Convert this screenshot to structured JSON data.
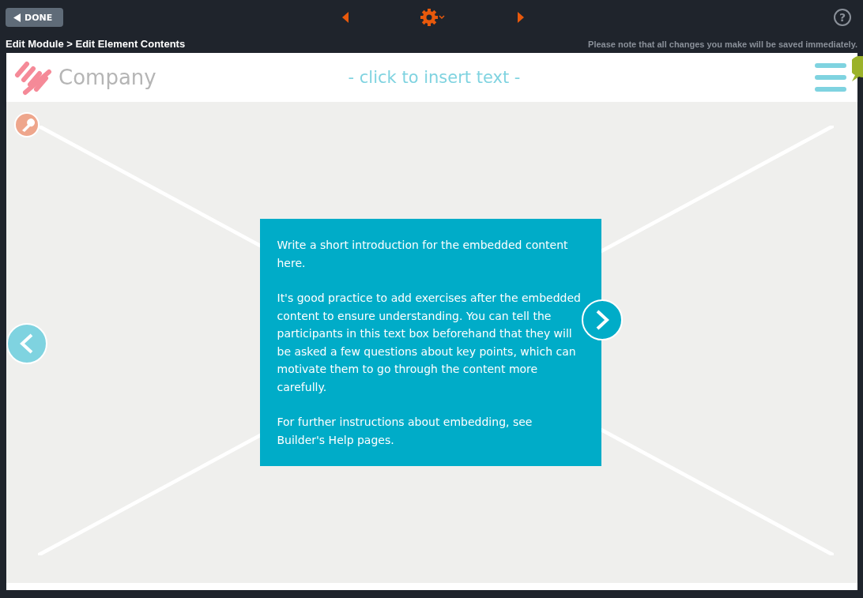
{
  "toolbar": {
    "done_button": "DONE",
    "breadcrumb": "Edit Module > Edit Element Contents",
    "notice": "Please note that all changes you make will be saved immediately.",
    "help": "?"
  },
  "header": {
    "logo_text": "Company",
    "title_placeholder": "- click to insert text -"
  },
  "text_box": {
    "paragraphs": [
      "Write a short introduction for the embedded content here.",
      "It's good practice to add exercises after the embedded content to ensure understanding. You can tell the participants in this text box beforehand that they will be asked a few questions about key points, which can motivate them to go through the content more carefully.",
      "For further instructions about embedding, see Builder's Help pages."
    ]
  }
}
